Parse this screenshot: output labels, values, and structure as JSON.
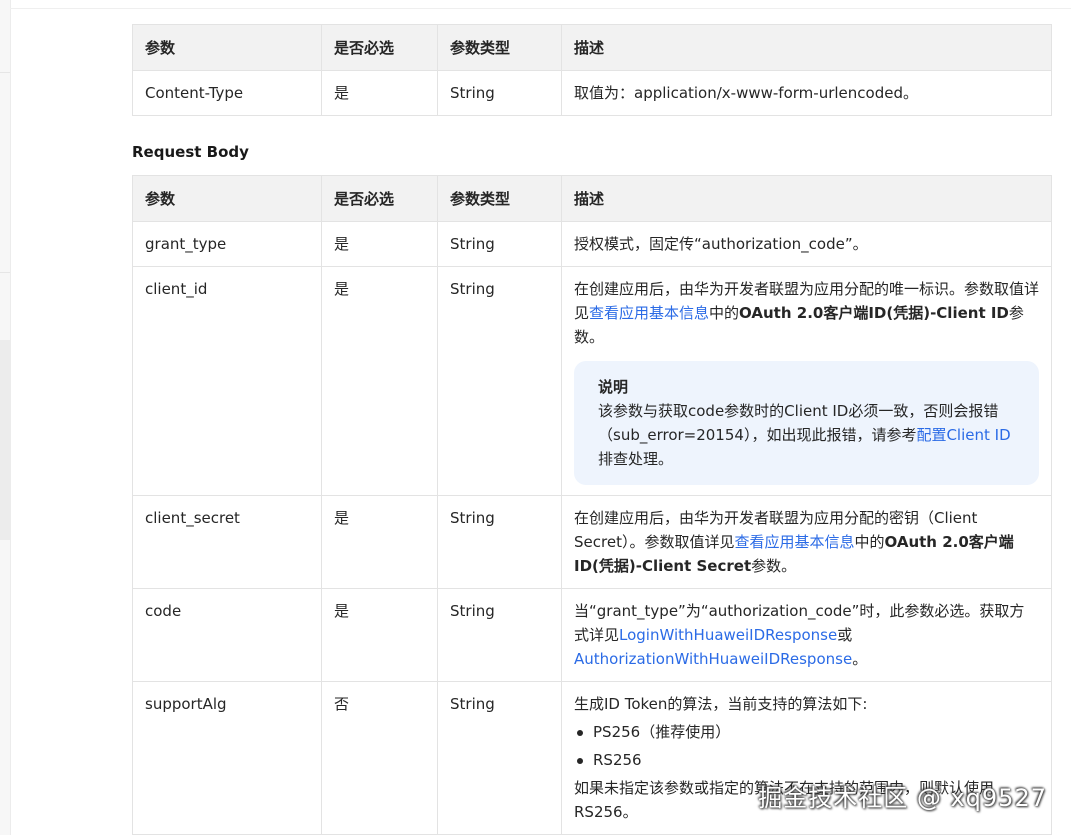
{
  "header_table": {
    "columns": [
      "参数",
      "是否必选",
      "参数类型",
      "描述"
    ],
    "row": {
      "param": "Content-Type",
      "required": "是",
      "type": "String",
      "desc": "取值为：application/x-www-form-urlencoded。"
    }
  },
  "request_body": {
    "title": "Request Body",
    "columns": [
      "参数",
      "是否必选",
      "参数类型",
      "描述"
    ],
    "rows": [
      {
        "param": "grant_type",
        "required": "是",
        "type": "String",
        "desc": "授权模式，固定传“authorization_code”。"
      },
      {
        "param": "client_id",
        "required": "是",
        "type": "String",
        "desc_pre": "在创建应用后，由华为开发者联盟为应用分配的唯一标识。参数取值详见",
        "desc_link": "查看应用基本信息",
        "desc_mid": "中的",
        "desc_bold": "OAuth 2.0客户端ID(凭据)-Client ID",
        "desc_post": "参数。",
        "note": {
          "title": "说明",
          "text_pre": "该参数与获取code参数时的Client ID必须一致，否则会报错（sub_error=20154），如出现此报错，请参考",
          "link": "配置Client ID",
          "text_post": "排查处理。"
        }
      },
      {
        "param": "client_secret",
        "required": "是",
        "type": "String",
        "desc_pre": "在创建应用后，由华为开发者联盟为应用分配的密钥（Client Secret）。参数取值详见",
        "desc_link": "查看应用基本信息",
        "desc_mid": "中的",
        "desc_bold": "OAuth 2.0客户端ID(凭据)-Client Secret",
        "desc_post": "参数。"
      },
      {
        "param": "code",
        "required": "是",
        "type": "String",
        "desc_pre": "当“grant_type”为“authorization_code”时，此参数必选。获取方式详见",
        "desc_link1": "LoginWithHuaweiIDResponse",
        "desc_mid": "或",
        "desc_link2": "AuthorizationWithHuaweiIDResponse",
        "desc_post": "。"
      },
      {
        "param": "supportAlg",
        "required": "否",
        "type": "String",
        "desc_intro": "生成ID Token的算法，当前支持的算法如下:",
        "algs": [
          "PS256（推荐使用）",
          "RS256"
        ],
        "desc_outro": "如果未指定该参数或指定的算法不在支持的范围内，则默认使用RS256。"
      }
    ]
  },
  "watermark": "掘金技术社区 @ xq9527"
}
